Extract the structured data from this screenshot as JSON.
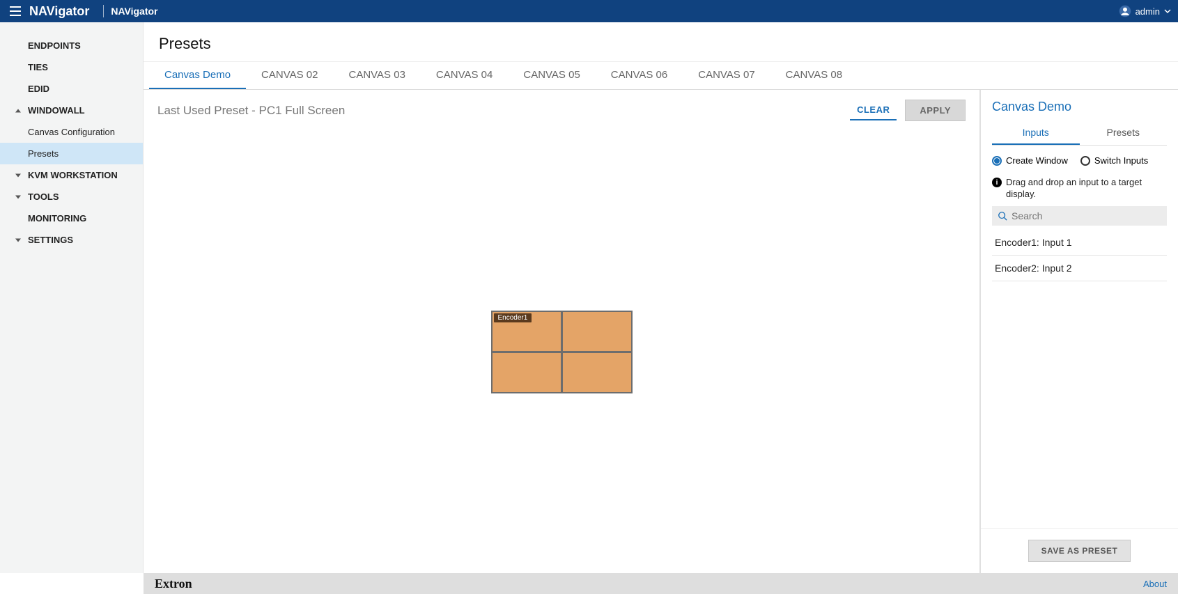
{
  "header": {
    "brand": "NAVigator",
    "subbrand": "NAVigator",
    "user": "admin"
  },
  "sidebar": {
    "endpoints": "ENDPOINTS",
    "ties": "TIES",
    "edid": "EDID",
    "windowall": "WINDOWALL",
    "canvas_config": "Canvas Configuration",
    "presets": "Presets",
    "kvm": "KVM WORKSTATION",
    "tools": "TOOLS",
    "monitoring": "MONITORING",
    "settings": "SETTINGS"
  },
  "page": {
    "title": "Presets",
    "tabs": [
      "Canvas Demo",
      "CANVAS 02",
      "CANVAS 03",
      "CANVAS 04",
      "CANVAS 05",
      "CANVAS 06",
      "CANVAS 07",
      "CANVAS 08"
    ],
    "active_tab": 0,
    "last_preset": "Last Used Preset - PC1 Full Screen",
    "clear": "CLEAR",
    "apply": "APPLY"
  },
  "wall": {
    "chip": "Encoder1"
  },
  "panel": {
    "title": "Canvas Demo",
    "tabs": {
      "inputs": "Inputs",
      "presets": "Presets"
    },
    "radio_create": "Create Window",
    "radio_switch": "Switch Inputs",
    "hint": "Drag and drop an input to a target display.",
    "search_placeholder": "Search",
    "inputs": [
      "Encoder1: Input 1",
      "Encoder2: Input 2"
    ],
    "save": "SAVE AS PRESET"
  },
  "footer": {
    "logo": "Extron",
    "about": "About"
  }
}
